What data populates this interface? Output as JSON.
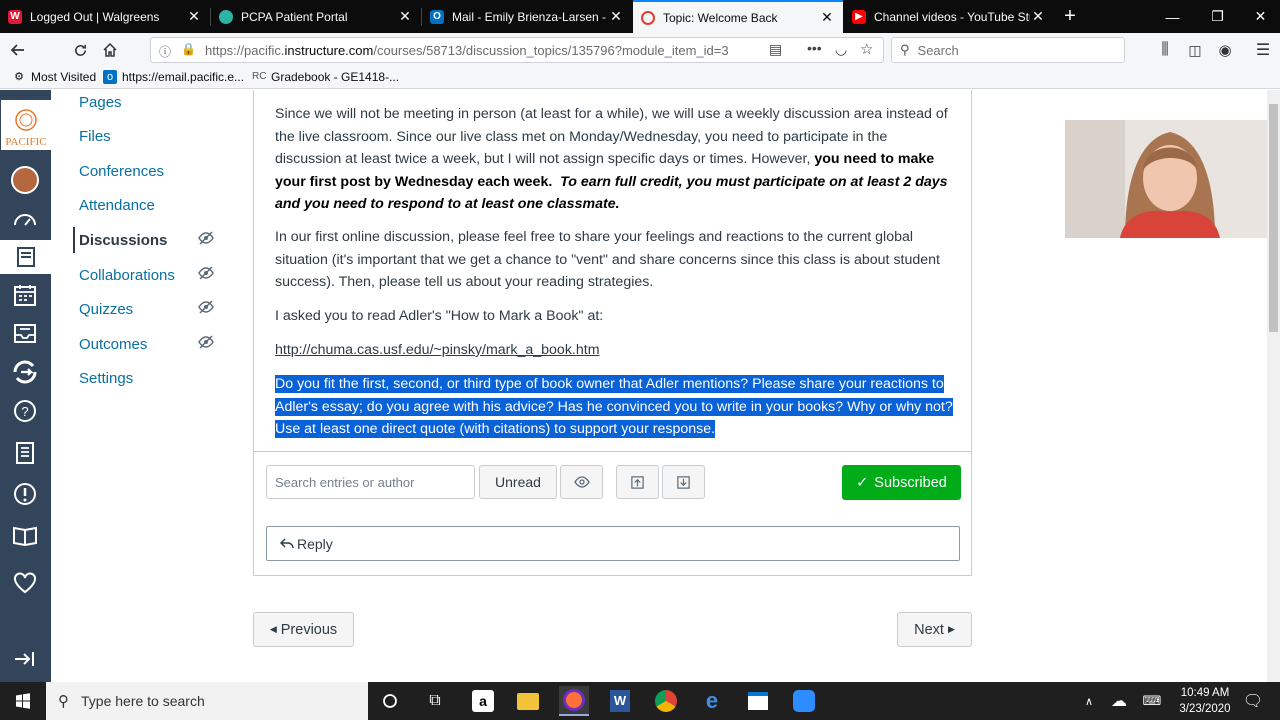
{
  "browser": {
    "tabs": [
      {
        "title": "Logged Out | Walgreens",
        "favicon": "walgreens-icon",
        "active": false
      },
      {
        "title": "PCPA Patient Portal",
        "favicon": "shield-icon",
        "active": false
      },
      {
        "title": "Mail - Emily Brienza-Larsen - O",
        "favicon": "outlook-icon",
        "active": false
      },
      {
        "title": "Topic: Welcome Back",
        "favicon": "loading-icon",
        "active": true
      },
      {
        "title": "Channel videos - YouTube Stud",
        "favicon": "youtube-icon",
        "active": false
      }
    ],
    "url_prefix": "https://pacific.",
    "url_host": "instructure.com",
    "url_path": "/courses/58713/discussion_topics/135796?module_item_id=3",
    "search_placeholder": "Search",
    "bookmarks": [
      {
        "label": "Most Visited",
        "icon": "gear-icon"
      },
      {
        "label": "https://email.pacific.e...",
        "icon": "outlook-icon"
      },
      {
        "label": "Gradebook - GE1418-...",
        "icon": "canvas-icon"
      }
    ]
  },
  "course_nav": [
    {
      "label": "Pages",
      "hidden": false
    },
    {
      "label": "Files",
      "hidden": false
    },
    {
      "label": "Conferences",
      "hidden": false
    },
    {
      "label": "Attendance",
      "hidden": false
    },
    {
      "label": "Discussions",
      "hidden": true,
      "active": true
    },
    {
      "label": "Collaborations",
      "hidden": true
    },
    {
      "label": "Quizzes",
      "hidden": true
    },
    {
      "label": "Outcomes",
      "hidden": true
    },
    {
      "label": "Settings",
      "hidden": false
    }
  ],
  "global_nav_logo": "UNIVERSITY OF THE PACIFIC",
  "message": {
    "p1_a": "Since we will not be meeting in person (at least for a while), we will use a weekly discussion area instead of the live classroom.  Since our live class met on Monday/Wednesday, you need to participate in the discussion at least twice a week, but I will not assign specific days or times.  However, ",
    "p1_bold": "you need to make your first post by Wednesday each week.",
    "p1_bold_italic": "To earn full credit, you must participate on at least 2 days and you need to respond to at least one classmate.",
    "p2": "In our first online discussion, please feel free to share your feelings and reactions to the current global situation (it's important that we get a chance to \"vent\" and share concerns since this class is about student success).  Then, please tell us about your reading strategies.",
    "p3": "I asked you to read Adler's \"How to Mark a Book\" at:",
    "link": "http://chuma.cas.usf.edu/~pinsky/mark_a_book.htm",
    "highlighted": "Do you fit the first, second, or third type of book owner that Adler mentions?   Please share your reactions to Adler's essay; do you agree with his advice?  Has he convinced you to write in your books?  Why or why not? Use at least one direct quote (with citations) to support your response."
  },
  "toolbar": {
    "search_placeholder": "Search entries or author",
    "unread_label": "Unread",
    "subscribed_label": "Subscribed"
  },
  "reply_label": "Reply",
  "pager": {
    "previous": "Previous",
    "next": "Next"
  },
  "taskbar": {
    "search_placeholder": "Type here to search",
    "time": "10:49 AM",
    "date": "3/23/2020"
  },
  "colors": {
    "canvas_nav": "#33455a",
    "link": "#0770a3",
    "subscribed": "#00ac18",
    "selection": "#0a62d9"
  }
}
